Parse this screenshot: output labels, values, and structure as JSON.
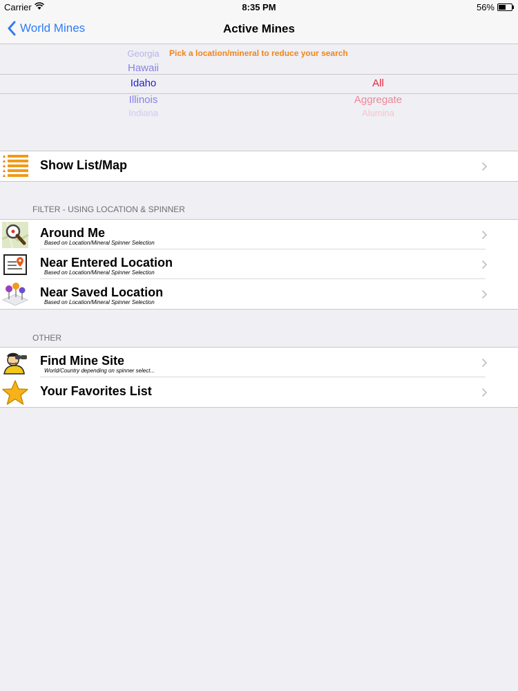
{
  "status_bar": {
    "carrier": "Carrier",
    "time": "8:35 PM",
    "battery": "56%",
    "battery_level": 0.56
  },
  "nav": {
    "back_label": "World Mines",
    "title": "Active Mines"
  },
  "picker": {
    "hint": "Pick a location/mineral to reduce your search",
    "location_items": [
      "Georgia",
      "Hawaii",
      "Idaho",
      "Illinois",
      "Indiana"
    ],
    "mineral_items": [
      "All",
      "Aggregate",
      "Alumina"
    ]
  },
  "show_list": {
    "label": "Show List/Map"
  },
  "filter_section": {
    "header": "FILTER - USING LOCATION & SPINNER",
    "items": [
      {
        "label": "Around Me",
        "sub": "Based on Location/Mineral Spinner Selection",
        "icon": "magnifier-map-icon"
      },
      {
        "label": "Near Entered Location",
        "sub": "Based on Location/Mineral Spinner Selection",
        "icon": "map-pin-card-icon"
      },
      {
        "label": "Near Saved Location",
        "sub": "Based on Location/Mineral Spinner Selection",
        "icon": "saved-pins-icon"
      }
    ]
  },
  "other_section": {
    "header": "OTHER",
    "items": [
      {
        "label": "Find Mine Site",
        "sub": "World/Country depending on spinner select...",
        "icon": "explorer-binoculars-icon"
      },
      {
        "label": "Your Favorites List",
        "icon": "star-icon"
      }
    ]
  },
  "colors": {
    "accent": "#2f7bf5",
    "hint": "#f0851a",
    "location_selected": "#2222cc",
    "mineral_selected": "#e8243a"
  }
}
